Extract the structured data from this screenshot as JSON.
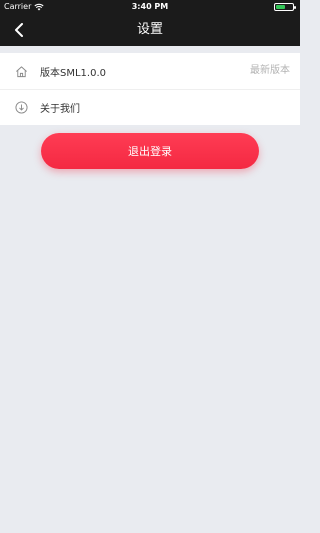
{
  "status": {
    "carrier": "Carrier",
    "time": "3:40 PM",
    "battery_level": 0.55,
    "battery_color": "#34c759"
  },
  "nav": {
    "title": "设置",
    "back_icon": "chevron-left-icon"
  },
  "settings": {
    "items": [
      {
        "icon": "home-icon",
        "label": "版本SML1.0.0",
        "value": "最新版本"
      },
      {
        "icon": "download-circle-icon",
        "label": "关于我们",
        "value": ""
      }
    ]
  },
  "logout": {
    "label": "退出登录",
    "color": "#f42942"
  }
}
